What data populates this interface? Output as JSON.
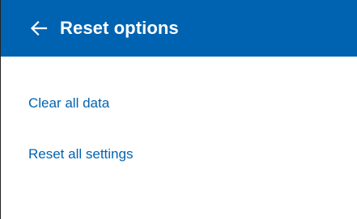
{
  "header": {
    "title": "Reset options",
    "back_icon": "arrow-left-icon",
    "background_color": "#0063B1"
  },
  "options": [
    {
      "label": "Clear all data"
    },
    {
      "label": "Reset all settings"
    }
  ],
  "colors": {
    "accent": "#0063B1",
    "link": "#0063B1",
    "header_text": "#FFFFFF",
    "background": "#FFFFFF"
  }
}
